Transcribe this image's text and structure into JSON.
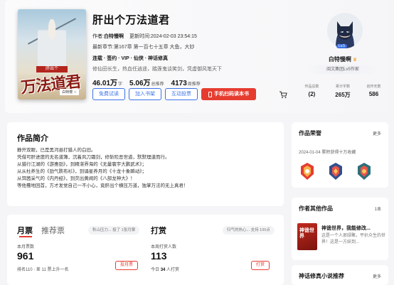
{
  "book": {
    "title": "肝出个万法道君",
    "author_prefix": "作者:",
    "author": "白特慢啊",
    "updated": "更新时间:2024-02-03 23:54:15",
    "latest_chapter": "最新章节:第167章 第一百七十五章 大鱼，大妙",
    "tags": "连载 · 签约 · VIP · 仙侠 · 神话修真",
    "short_intro": "修仙田长生，热血任逍遥，踏莲鬼谈笑剑，凭虚御风笔天下",
    "words_value": "46.01万",
    "words_unit": "字",
    "total_rec_value": "5.06万",
    "total_rec_unit": "总推荐",
    "weekly_rec_value": "4173",
    "weekly_rec_unit": "周推荐",
    "cover_badge": "肝出个",
    "cover_title": "万法道君",
    "cover_author": "白特慢 ☆"
  },
  "actions": {
    "free_trial": "免费试读",
    "add_shelf": "加入书架",
    "vote": "互动投票",
    "mobile_read": "手机扫码读本书"
  },
  "author_panel": {
    "name": "白特慢啊",
    "level": "阅文集团Lv5作家",
    "lv_badge": "Lv.5",
    "stats": [
      {
        "label": "作品总数",
        "value": "2"
      },
      {
        "label": "累计字数",
        "value": "265万"
      },
      {
        "label": "创作天数",
        "value": "586"
      }
    ]
  },
  "intro": {
    "title": "作品简介",
    "lines": [
      "静开双眼，已是黑河县打猎人的白旧。",
      "凭借可肝进度的无名道簿，沉着风刀霜剑，修斩险恶世道，默默理道而行。",
      "从猎行江湖的《游惠劲》，到精湛界海的《无量寰宇大鹏武术》；",
      "从从杜养生的《劲气跌布衫》，到诵星养月的《十龙十象瞬动》；",
      "从饵茜采气的《内丹经》，到荧出黄闻的《八部龙神大》！",
      "等他蓦地回首，方才发觉自己一不小心，竟肝出个横压万道，独掌万法的无上真君！"
    ]
  },
  "monthly": {
    "tab_monthly": "月票",
    "tab_recommend": "推荐票",
    "pill": "秋山压力... 投了 1张月票",
    "this_month_label": "本月票数",
    "this_month_value": "961",
    "rank_line": "排名110 · 差 11 票上升一名",
    "vote_button": "投月票"
  },
  "reward": {
    "title": "打赏",
    "pill": "归气的热心... 支持 100点",
    "this_month_label": "本周打赏人数",
    "value": "113",
    "today_prefix": "今日",
    "today_count": "34",
    "today_suffix": "人打赏",
    "button": "打赏"
  },
  "honor": {
    "title": "作品荣誉",
    "more": "更多",
    "line": "2024-01-04 累积获得十万收藏"
  },
  "other_works": {
    "title": "作者其他作品",
    "count": "1本",
    "book_title": "神诡世界，我能修改...",
    "book_desc": "这是一个人邪绿聚，平扒众生的世界！这是一方妖到...",
    "cover_text": "神诡世界"
  },
  "rec_section": {
    "title": "神话修真小说推荐",
    "more": "更多"
  },
  "colors": {
    "accent_blue": "#3a73e6",
    "accent_red": "#e63c30"
  }
}
